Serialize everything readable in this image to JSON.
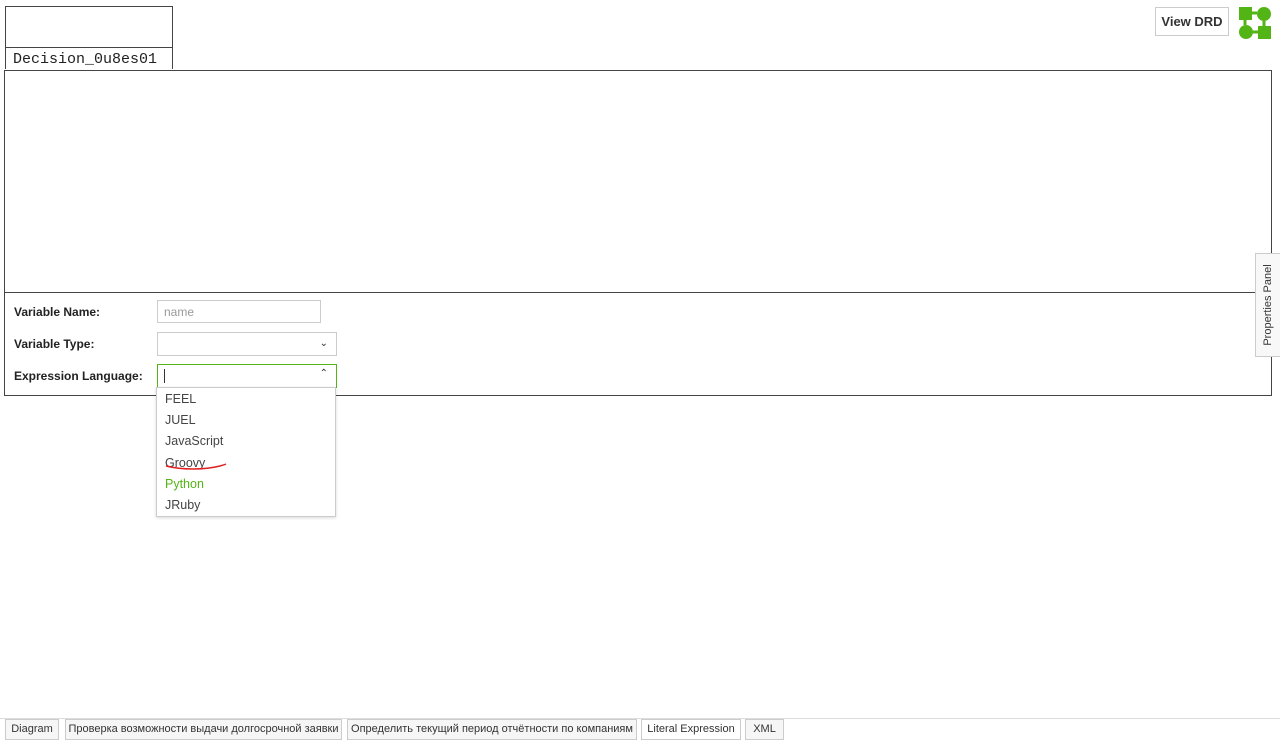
{
  "decision": {
    "name": "Decision_0u8es01"
  },
  "header": {
    "view_drd_label": "View DRD",
    "logo_icon": "dmn-logo-icon",
    "brand_color": "#52b415"
  },
  "properties": {
    "variable_name": {
      "label": "Variable Name:",
      "value": "",
      "placeholder": "name"
    },
    "variable_type": {
      "label": "Variable Type:",
      "value": ""
    },
    "expression_language": {
      "label": "Expression Language:",
      "value": "",
      "options": [
        "FEEL",
        "JUEL",
        "JavaScript",
        "Groovy",
        "Python",
        "JRuby"
      ],
      "highlighted_option": "Python",
      "annotated_option": "Groovy"
    }
  },
  "side_panel": {
    "label": "Properties Panel"
  },
  "tabs": [
    {
      "label": "Diagram"
    },
    {
      "label": "Проверка возможности выдачи долгосрочной заявки"
    },
    {
      "label": "Определить текущий период отчётности по компаниям"
    },
    {
      "label": "Literal Expression",
      "active": true
    },
    {
      "label": "XML"
    }
  ]
}
